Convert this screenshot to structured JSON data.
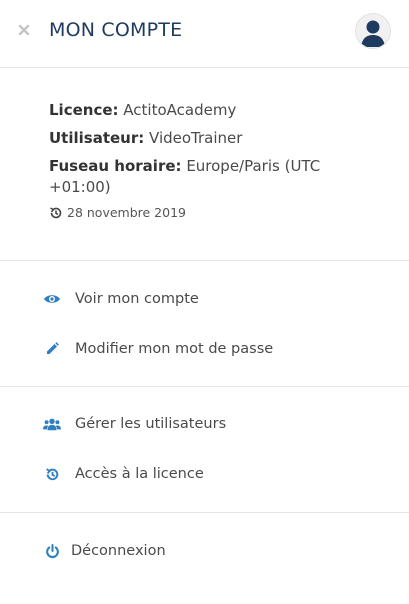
{
  "header": {
    "title": "MON COMPTE",
    "close_icon": "close-icon",
    "avatar_icon": "user-icon"
  },
  "info": {
    "licence_label": "Licence:",
    "licence_value": "ActitoAcademy",
    "user_label": "Utilisateur:",
    "user_value": "VideoTrainer",
    "timezone_label": "Fuseau horaire:",
    "timezone_value": "Europe/Paris (UTC +01:00)",
    "date": "28 novembre 2019"
  },
  "menu": {
    "view_account": "Voir mon compte",
    "change_password": "Modifier mon mot de passe",
    "manage_users": "Gérer les utilisateurs",
    "licence_access": "Accès à la licence",
    "logout": "Déconnexion"
  },
  "colors": {
    "accent": "#2f7fc1",
    "title": "#1f3a5f",
    "divider": "#e6e6e6"
  }
}
